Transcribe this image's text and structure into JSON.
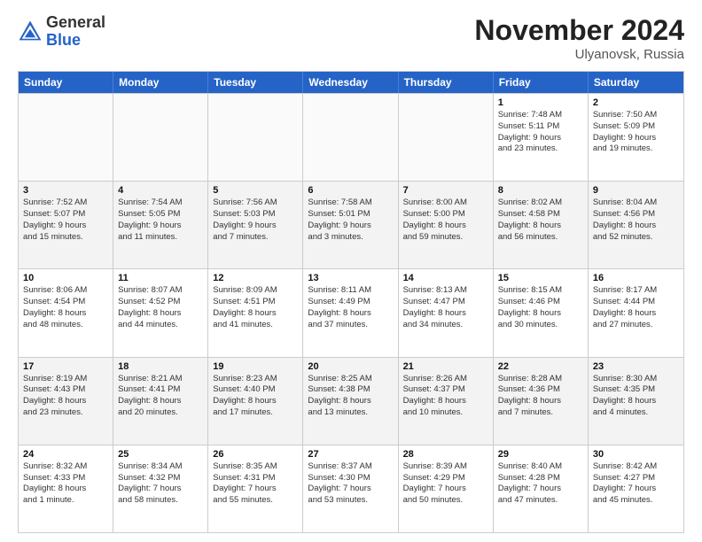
{
  "logo": {
    "general": "General",
    "blue": "Blue"
  },
  "title": "November 2024",
  "location": "Ulyanovsk, Russia",
  "days_header": [
    "Sunday",
    "Monday",
    "Tuesday",
    "Wednesday",
    "Thursday",
    "Friday",
    "Saturday"
  ],
  "rows": [
    [
      {
        "day": "",
        "lines": [],
        "empty": true
      },
      {
        "day": "",
        "lines": [],
        "empty": true
      },
      {
        "day": "",
        "lines": [],
        "empty": true
      },
      {
        "day": "",
        "lines": [],
        "empty": true
      },
      {
        "day": "",
        "lines": [],
        "empty": true
      },
      {
        "day": "1",
        "lines": [
          "Sunrise: 7:48 AM",
          "Sunset: 5:11 PM",
          "Daylight: 9 hours",
          "and 23 minutes."
        ],
        "empty": false
      },
      {
        "day": "2",
        "lines": [
          "Sunrise: 7:50 AM",
          "Sunset: 5:09 PM",
          "Daylight: 9 hours",
          "and 19 minutes."
        ],
        "empty": false
      }
    ],
    [
      {
        "day": "3",
        "lines": [
          "Sunrise: 7:52 AM",
          "Sunset: 5:07 PM",
          "Daylight: 9 hours",
          "and 15 minutes."
        ],
        "empty": false
      },
      {
        "day": "4",
        "lines": [
          "Sunrise: 7:54 AM",
          "Sunset: 5:05 PM",
          "Daylight: 9 hours",
          "and 11 minutes."
        ],
        "empty": false
      },
      {
        "day": "5",
        "lines": [
          "Sunrise: 7:56 AM",
          "Sunset: 5:03 PM",
          "Daylight: 9 hours",
          "and 7 minutes."
        ],
        "empty": false
      },
      {
        "day": "6",
        "lines": [
          "Sunrise: 7:58 AM",
          "Sunset: 5:01 PM",
          "Daylight: 9 hours",
          "and 3 minutes."
        ],
        "empty": false
      },
      {
        "day": "7",
        "lines": [
          "Sunrise: 8:00 AM",
          "Sunset: 5:00 PM",
          "Daylight: 8 hours",
          "and 59 minutes."
        ],
        "empty": false
      },
      {
        "day": "8",
        "lines": [
          "Sunrise: 8:02 AM",
          "Sunset: 4:58 PM",
          "Daylight: 8 hours",
          "and 56 minutes."
        ],
        "empty": false
      },
      {
        "day": "9",
        "lines": [
          "Sunrise: 8:04 AM",
          "Sunset: 4:56 PM",
          "Daylight: 8 hours",
          "and 52 minutes."
        ],
        "empty": false
      }
    ],
    [
      {
        "day": "10",
        "lines": [
          "Sunrise: 8:06 AM",
          "Sunset: 4:54 PM",
          "Daylight: 8 hours",
          "and 48 minutes."
        ],
        "empty": false
      },
      {
        "day": "11",
        "lines": [
          "Sunrise: 8:07 AM",
          "Sunset: 4:52 PM",
          "Daylight: 8 hours",
          "and 44 minutes."
        ],
        "empty": false
      },
      {
        "day": "12",
        "lines": [
          "Sunrise: 8:09 AM",
          "Sunset: 4:51 PM",
          "Daylight: 8 hours",
          "and 41 minutes."
        ],
        "empty": false
      },
      {
        "day": "13",
        "lines": [
          "Sunrise: 8:11 AM",
          "Sunset: 4:49 PM",
          "Daylight: 8 hours",
          "and 37 minutes."
        ],
        "empty": false
      },
      {
        "day": "14",
        "lines": [
          "Sunrise: 8:13 AM",
          "Sunset: 4:47 PM",
          "Daylight: 8 hours",
          "and 34 minutes."
        ],
        "empty": false
      },
      {
        "day": "15",
        "lines": [
          "Sunrise: 8:15 AM",
          "Sunset: 4:46 PM",
          "Daylight: 8 hours",
          "and 30 minutes."
        ],
        "empty": false
      },
      {
        "day": "16",
        "lines": [
          "Sunrise: 8:17 AM",
          "Sunset: 4:44 PM",
          "Daylight: 8 hours",
          "and 27 minutes."
        ],
        "empty": false
      }
    ],
    [
      {
        "day": "17",
        "lines": [
          "Sunrise: 8:19 AM",
          "Sunset: 4:43 PM",
          "Daylight: 8 hours",
          "and 23 minutes."
        ],
        "empty": false
      },
      {
        "day": "18",
        "lines": [
          "Sunrise: 8:21 AM",
          "Sunset: 4:41 PM",
          "Daylight: 8 hours",
          "and 20 minutes."
        ],
        "empty": false
      },
      {
        "day": "19",
        "lines": [
          "Sunrise: 8:23 AM",
          "Sunset: 4:40 PM",
          "Daylight: 8 hours",
          "and 17 minutes."
        ],
        "empty": false
      },
      {
        "day": "20",
        "lines": [
          "Sunrise: 8:25 AM",
          "Sunset: 4:38 PM",
          "Daylight: 8 hours",
          "and 13 minutes."
        ],
        "empty": false
      },
      {
        "day": "21",
        "lines": [
          "Sunrise: 8:26 AM",
          "Sunset: 4:37 PM",
          "Daylight: 8 hours",
          "and 10 minutes."
        ],
        "empty": false
      },
      {
        "day": "22",
        "lines": [
          "Sunrise: 8:28 AM",
          "Sunset: 4:36 PM",
          "Daylight: 8 hours",
          "and 7 minutes."
        ],
        "empty": false
      },
      {
        "day": "23",
        "lines": [
          "Sunrise: 8:30 AM",
          "Sunset: 4:35 PM",
          "Daylight: 8 hours",
          "and 4 minutes."
        ],
        "empty": false
      }
    ],
    [
      {
        "day": "24",
        "lines": [
          "Sunrise: 8:32 AM",
          "Sunset: 4:33 PM",
          "Daylight: 8 hours",
          "and 1 minute."
        ],
        "empty": false
      },
      {
        "day": "25",
        "lines": [
          "Sunrise: 8:34 AM",
          "Sunset: 4:32 PM",
          "Daylight: 7 hours",
          "and 58 minutes."
        ],
        "empty": false
      },
      {
        "day": "26",
        "lines": [
          "Sunrise: 8:35 AM",
          "Sunset: 4:31 PM",
          "Daylight: 7 hours",
          "and 55 minutes."
        ],
        "empty": false
      },
      {
        "day": "27",
        "lines": [
          "Sunrise: 8:37 AM",
          "Sunset: 4:30 PM",
          "Daylight: 7 hours",
          "and 53 minutes."
        ],
        "empty": false
      },
      {
        "day": "28",
        "lines": [
          "Sunrise: 8:39 AM",
          "Sunset: 4:29 PM",
          "Daylight: 7 hours",
          "and 50 minutes."
        ],
        "empty": false
      },
      {
        "day": "29",
        "lines": [
          "Sunrise: 8:40 AM",
          "Sunset: 4:28 PM",
          "Daylight: 7 hours",
          "and 47 minutes."
        ],
        "empty": false
      },
      {
        "day": "30",
        "lines": [
          "Sunrise: 8:42 AM",
          "Sunset: 4:27 PM",
          "Daylight: 7 hours",
          "and 45 minutes."
        ],
        "empty": false
      }
    ]
  ]
}
